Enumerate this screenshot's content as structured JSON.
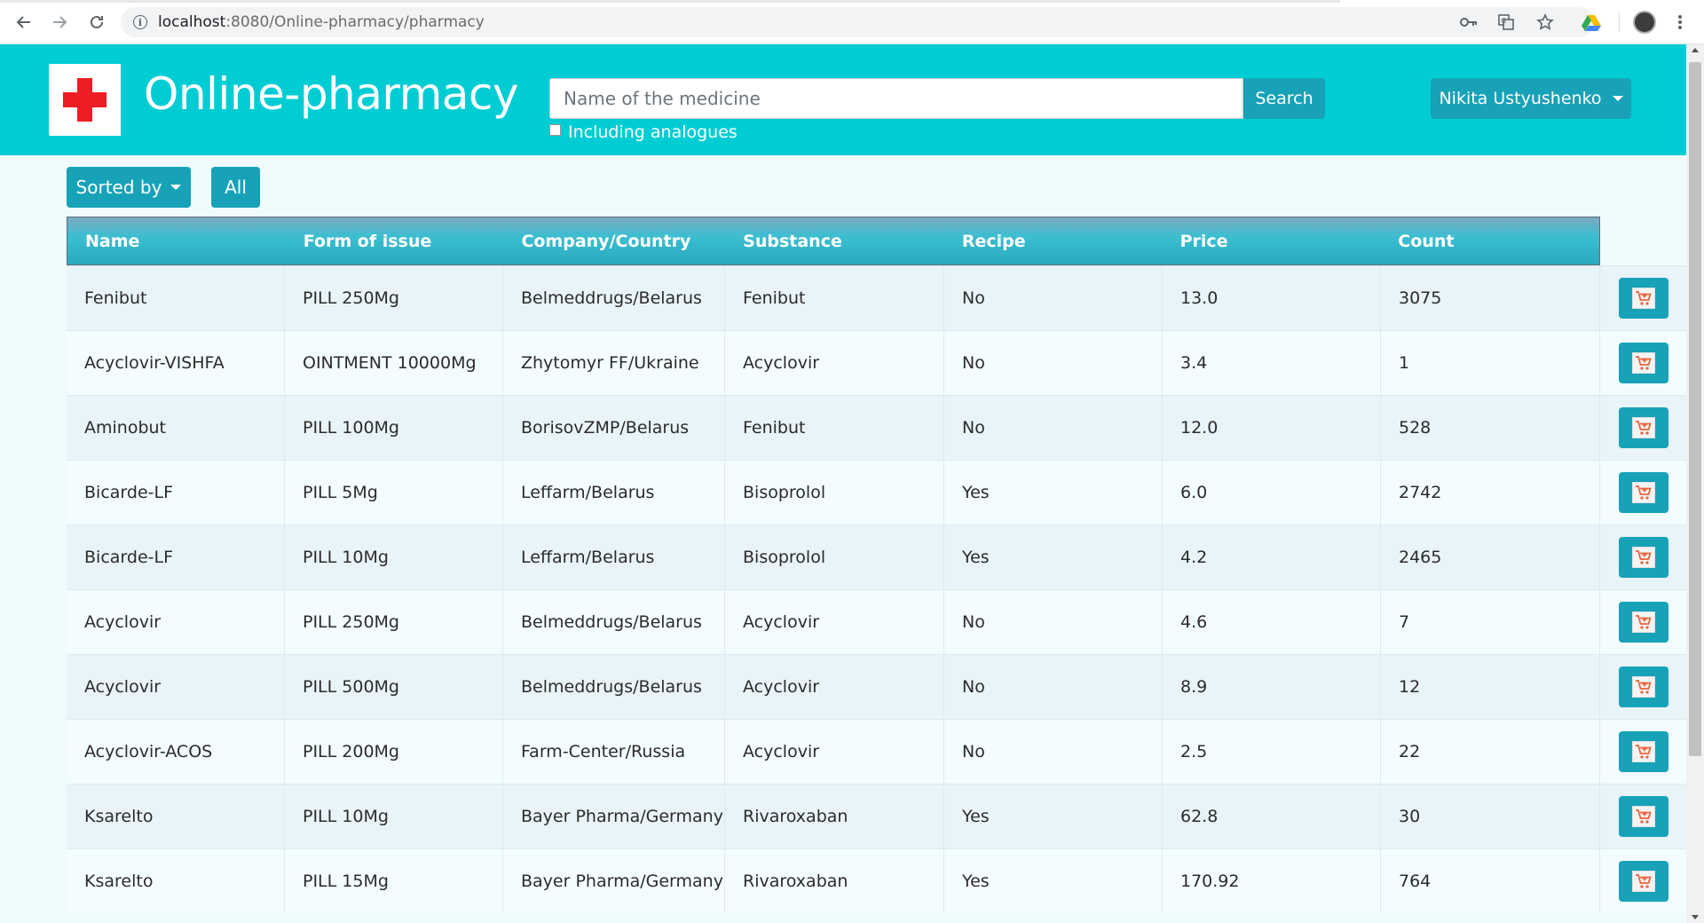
{
  "browser": {
    "url_host": "localhost",
    "url_rest": ":8080/Online-pharmacy/pharmacy",
    "icons": [
      "back-icon",
      "forward-icon",
      "reload-icon",
      "info-icon",
      "key-icon",
      "translate-icon",
      "star-icon",
      "drive-icon",
      "avatar",
      "menu-icon"
    ]
  },
  "header": {
    "brand": "Online-pharmacy",
    "search_placeholder": "Name of the medicine",
    "search_label": "Search",
    "analogues_label": "Including analogues",
    "user_label": "Nikita Ustyushenko"
  },
  "filters": {
    "sorted_label": "Sorted by",
    "all_label": "All"
  },
  "table": {
    "columns": [
      "Name",
      "Form of issue",
      "Company/Country",
      "Substance",
      "Recipe",
      "Price",
      "Count"
    ],
    "rows": [
      [
        "Fenibut",
        "PILL 250Mg",
        "Belmeddrugs/Belarus",
        "Fenibut",
        "No",
        "13.0",
        "3075"
      ],
      [
        "Acyclovir-VISHFA",
        "OINTMENT 10000Mg",
        "Zhytomyr FF/Ukraine",
        "Acyclovir",
        "No",
        "3.4",
        "1"
      ],
      [
        "Aminobut",
        "PILL 100Mg",
        "BorisovZMP/Belarus",
        "Fenibut",
        "No",
        "12.0",
        "528"
      ],
      [
        "Bicarde-LF",
        "PILL 5Mg",
        "Leffarm/Belarus",
        "Bisoprolol",
        "Yes",
        "6.0",
        "2742"
      ],
      [
        "Bicarde-LF",
        "PILL 10Mg",
        "Leffarm/Belarus",
        "Bisoprolol",
        "Yes",
        "4.2",
        "2465"
      ],
      [
        "Acyclovir",
        "PILL 250Mg",
        "Belmeddrugs/Belarus",
        "Acyclovir",
        "No",
        "4.6",
        "7"
      ],
      [
        "Acyclovir",
        "PILL 500Mg",
        "Belmeddrugs/Belarus",
        "Acyclovir",
        "No",
        "8.9",
        "12"
      ],
      [
        "Acyclovir-ACOS",
        "PILL 200Mg",
        "Farm-Center/Russia",
        "Acyclovir",
        "No",
        "2.5",
        "22"
      ],
      [
        "Ksarelto",
        "PILL 10Mg",
        "Bayer Pharma/Germany",
        "Rivaroxaban",
        "Yes",
        "62.8",
        "30"
      ],
      [
        "Ksarelto",
        "PILL 15Mg",
        "Bayer Pharma/Germany",
        "Rivaroxaban",
        "Yes",
        "170.92",
        "764"
      ]
    ],
    "row_action_icon": "cart-plus-icon"
  },
  "colors": {
    "header_bg": "#00cdd3",
    "button_bg": "#17a2b8",
    "logo_cross": "#ee1d23"
  }
}
